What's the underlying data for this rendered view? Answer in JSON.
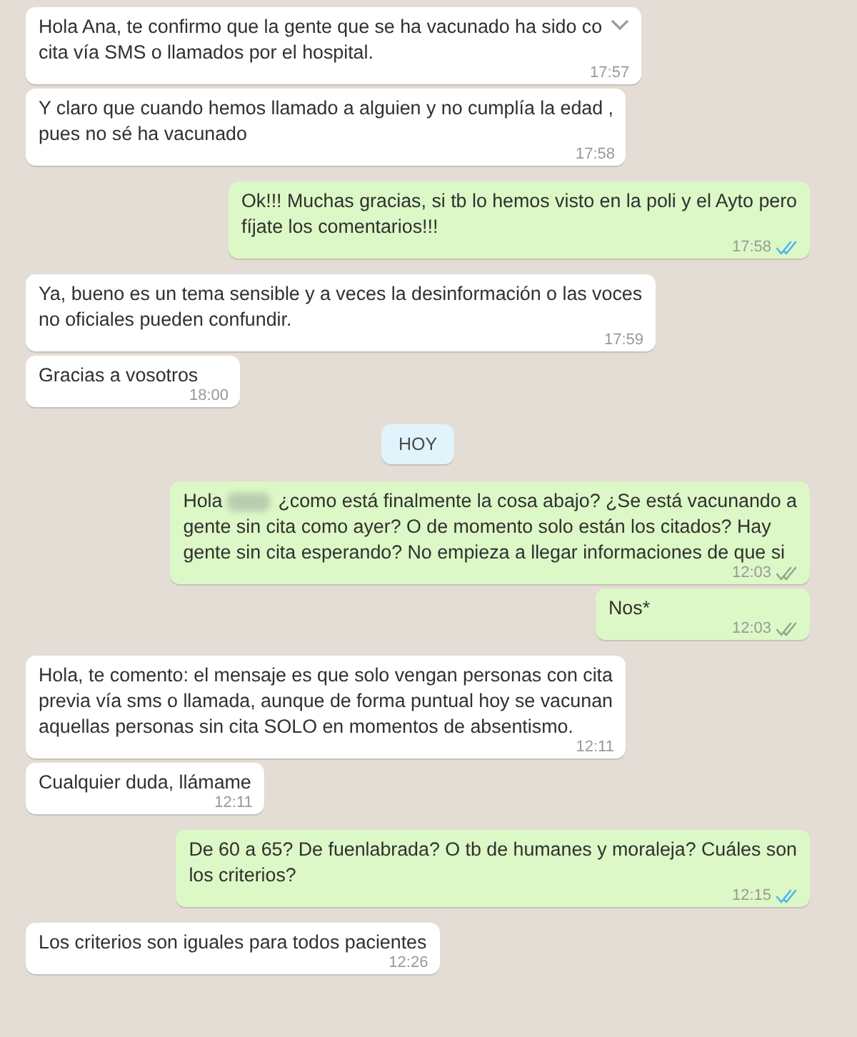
{
  "messages": [
    {
      "kind": "message",
      "outgoing": false,
      "lines": [
        "Hola Ana, te confirmo que la gente que se ha vacunado ha sido co",
        "cita vía SMS o llamados por el hospital."
      ],
      "time": "17:57",
      "menu_chevron": true
    },
    {
      "kind": "message",
      "outgoing": false,
      "lines": [
        "Y claro que cuando hemos llamado a alguien y no cumplía la edad ,",
        "pues no sé ha vacunado"
      ],
      "time": "17:58"
    },
    {
      "kind": "message",
      "outgoing": true,
      "lines": [
        "Ok!!! Muchas gracias, si tb lo hemos visto en la poli y el Ayto pero",
        "fíjate los comentarios!!!"
      ],
      "time": "17:58",
      "read": true
    },
    {
      "kind": "message",
      "outgoing": false,
      "lines": [
        "Ya, bueno es un tema sensible y a veces la desinformación o las voces",
        "no oficiales pueden confundir."
      ],
      "time": "17:59"
    },
    {
      "kind": "message",
      "outgoing": false,
      "lines": [
        "Gracias a vosotros"
      ],
      "time": "18:00"
    },
    {
      "kind": "date",
      "label": "HOY"
    },
    {
      "kind": "message",
      "outgoing": true,
      "greeting": "Hola",
      "redacted_name": true,
      "lines": [
        "¿como está finalmente la cosa abajo? ¿Se está vacunando a",
        "gente sin cita como ayer? O de momento solo están los citados? Hay",
        "gente sin cita esperando? No empieza a llegar informaciones de que si"
      ],
      "time": "12:03",
      "read": false
    },
    {
      "kind": "message",
      "outgoing": true,
      "lines": [
        "Nos*"
      ],
      "time": "12:03",
      "read": false
    },
    {
      "kind": "message",
      "outgoing": false,
      "lines": [
        "Hola, te comento: el mensaje es que solo vengan personas con cita",
        "previa vía sms o llamada, aunque de forma puntual hoy se vacunan",
        "aquellas personas sin cita SOLO en momentos de absentismo."
      ],
      "time": "12:11"
    },
    {
      "kind": "message",
      "outgoing": false,
      "lines": [
        "Cualquier duda, llámame"
      ],
      "time": "12:11"
    },
    {
      "kind": "message",
      "outgoing": true,
      "lines": [
        "De 60 a 65? De fuenlabrada? O tb de humanes y moraleja? Cuáles son",
        "los criterios?"
      ],
      "time": "12:15",
      "read": true
    },
    {
      "kind": "message",
      "outgoing": false,
      "lines": [
        "Los criterios son iguales para todos pacientes"
      ],
      "time": "12:26"
    }
  ]
}
